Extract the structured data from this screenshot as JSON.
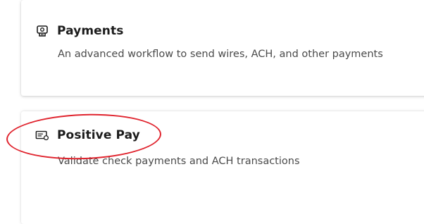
{
  "cards": [
    {
      "title": "Payments",
      "description": "An advanced workflow to send wires, ACH, and other payments",
      "icon": "payments-icon"
    },
    {
      "title": "Positive Pay",
      "description": "Validate check payments and ACH transactions",
      "icon": "positive-pay-icon"
    }
  ],
  "colors": {
    "title": "#1c1c1c",
    "description": "#4a4a4a",
    "annotation": "#e0242e"
  }
}
